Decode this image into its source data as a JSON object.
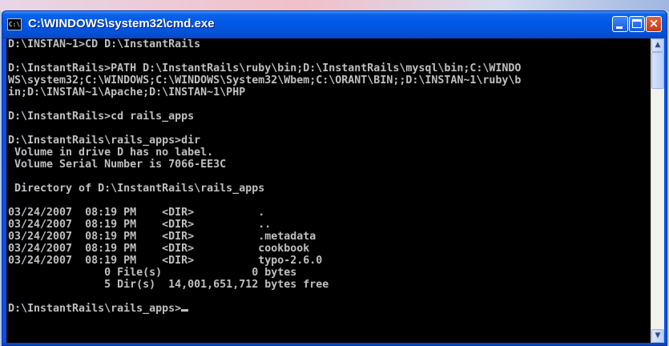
{
  "window": {
    "title": "C:\\WINDOWS\\system32\\cmd.exe",
    "icon": "cmd-icon",
    "icon_glyph": "C:\\",
    "controls": {
      "minimize_icon": "minimize-icon",
      "maximize_icon": "maximize-icon",
      "close_icon": "close-icon",
      "close_glyph": "×"
    }
  },
  "console": {
    "lines": [
      "D:\\INSTAN~1>CD D:\\InstantRails",
      "",
      "D:\\InstantRails>PATH D:\\InstantRails\\ruby\\bin;D:\\InstantRails\\mysql\\bin;C:\\WINDO",
      "WS\\system32;C:\\WINDOWS;C:\\WINDOWS\\System32\\Wbem;C:\\ORANT\\BIN;;D:\\INSTAN~1\\ruby\\b",
      "in;D:\\INSTAN~1\\Apache;D:\\INSTAN~1\\PHP",
      "",
      "D:\\InstantRails>cd rails_apps",
      "",
      "D:\\InstantRails\\rails_apps>dir",
      " Volume in drive D has no label.",
      " Volume Serial Number is 7066-EE3C",
      "",
      " Directory of D:\\InstantRails\\rails_apps",
      "",
      "03/24/2007  08:19 PM    <DIR>          .",
      "03/24/2007  08:19 PM    <DIR>          ..",
      "03/24/2007  08:19 PM    <DIR>          .metadata",
      "03/24/2007  08:19 PM    <DIR>          cookbook",
      "03/24/2007  08:19 PM    <DIR>          typo-2.6.0",
      "               0 File(s)              0 bytes",
      "               5 Dir(s)  14,001,651,712 bytes free",
      "",
      "D:\\InstantRails\\rails_apps>"
    ],
    "text_color": "#c0c0c0",
    "background": "#000000"
  },
  "scrollbar": {
    "up_glyph": "▲",
    "down_glyph": "▼"
  }
}
